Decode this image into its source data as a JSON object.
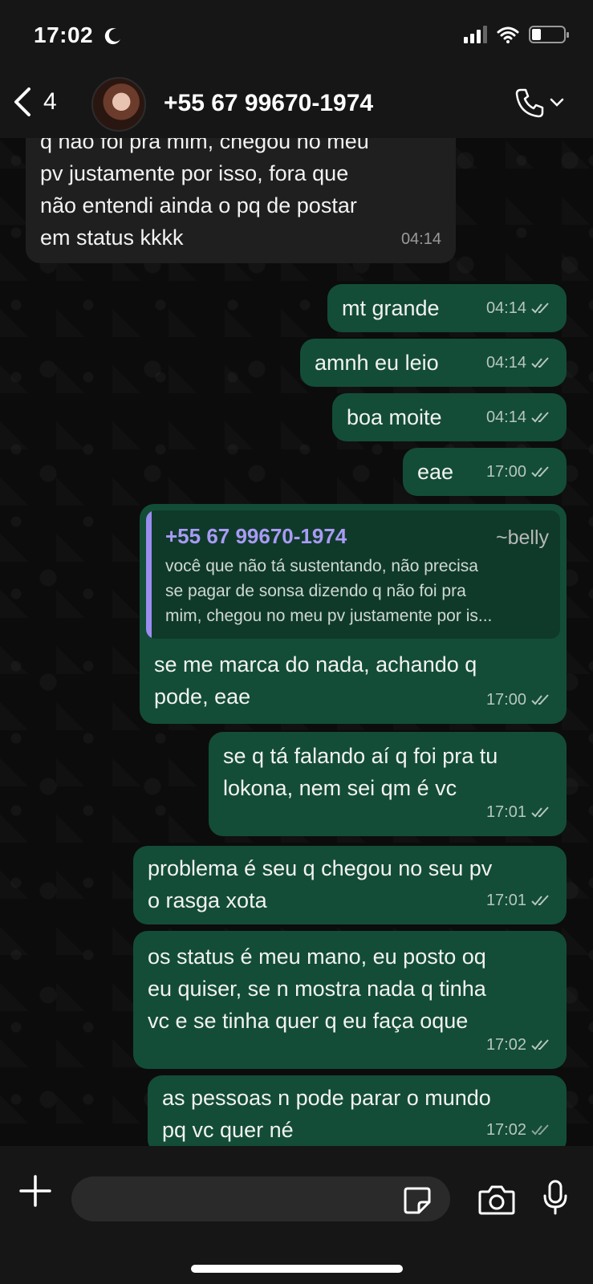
{
  "status_bar": {
    "time": "17:02",
    "battery_level": 0.3
  },
  "header": {
    "back_count": "4",
    "contact_name": "+55 67 99670-1974"
  },
  "messages": [
    {
      "direction": "in",
      "lines": [
        "q não foi pra mim, chegou no meu",
        "pv justamente por isso, fora que",
        "não entendi ainda o pq de postar",
        "em status kkkk"
      ],
      "time": "04:14"
    },
    {
      "direction": "out",
      "lines": [
        "mt grande"
      ],
      "time": "04:14"
    },
    {
      "direction": "out",
      "lines": [
        "amnh eu leio"
      ],
      "time": "04:14"
    },
    {
      "direction": "out",
      "lines": [
        "boa moite"
      ],
      "time": "04:14"
    },
    {
      "direction": "out",
      "lines": [
        "eae"
      ],
      "time": "17:00"
    },
    {
      "direction": "out",
      "reply": {
        "author": "+55 67 99670-1974",
        "handle": "~belly",
        "lines": [
          "você que não tá sustentando, não precisa",
          "se pagar de sonsa dizendo q não foi pra",
          "mim, chegou no meu pv justamente por is..."
        ]
      },
      "lines": [
        "se me marca do nada, achando q",
        "pode, eae"
      ],
      "time": "17:00"
    },
    {
      "direction": "out",
      "lines": [
        "se q tá falando aí q foi pra tu",
        "lokona, nem sei qm é vc"
      ],
      "time": "17:01"
    },
    {
      "direction": "out",
      "lines": [
        "problema é seu q chegou no seu pv",
        "o rasga xota"
      ],
      "time": "17:01"
    },
    {
      "direction": "out",
      "lines": [
        "os status é meu mano, eu posto oq",
        "eu quiser, se n mostra nada q tinha",
        "vc e se tinha quer q eu faça oque"
      ],
      "time": "17:02"
    },
    {
      "direction": "out",
      "lines": [
        "as pessoas n pode parar o mundo",
        "pq vc quer né"
      ],
      "time": "17:02"
    }
  ],
  "colors": {
    "outgoing_bubble": "#134d37",
    "incoming_bubble": "#1f1f1f",
    "reply_accent": "#9b8df0"
  },
  "icons": [
    "back-chevron-icon",
    "phone-icon",
    "chevron-down-icon",
    "plus-icon",
    "sticker-icon",
    "camera-icon",
    "microphone-icon",
    "double-check-icon",
    "moon-icon",
    "wifi-icon",
    "signal-icon",
    "battery-icon"
  ]
}
